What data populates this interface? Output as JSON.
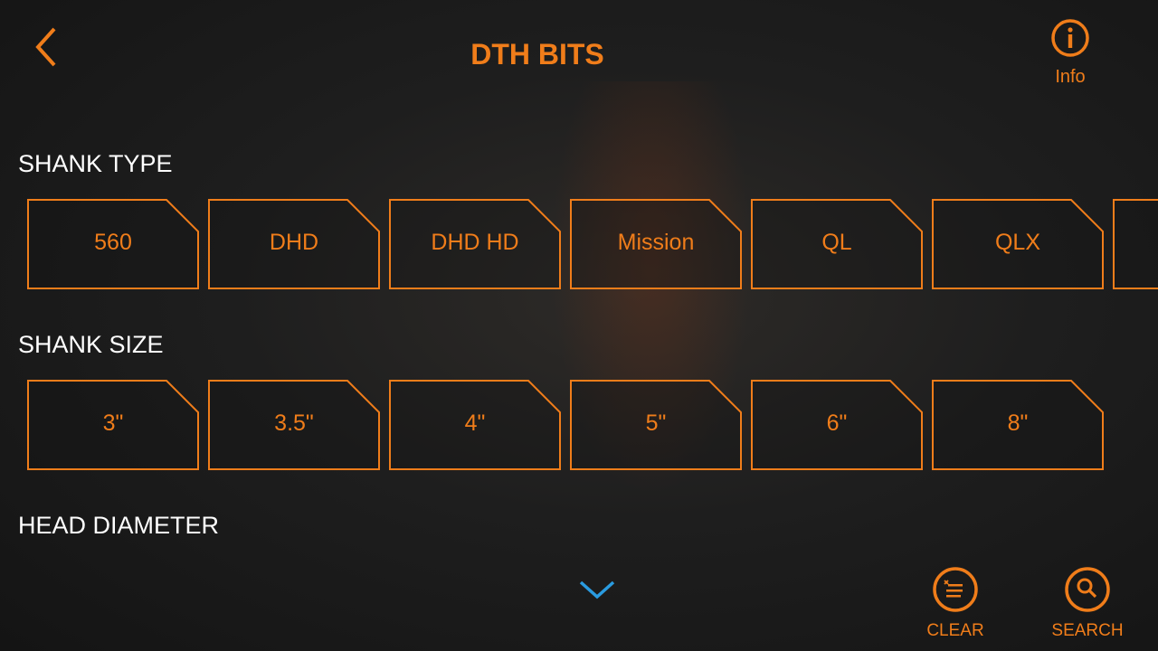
{
  "header": {
    "title": "DTH BITS",
    "info_label": "Info",
    "back_icon": "chevron-left-icon",
    "info_icon": "info-circle-icon"
  },
  "colors": {
    "accent": "#f07d1a",
    "scroll_indicator": "#2a9be0"
  },
  "sections": [
    {
      "title": "SHANK TYPE",
      "options": [
        "560",
        "DHD",
        "DHD HD",
        "Mission",
        "QL",
        "QLX",
        ""
      ]
    },
    {
      "title": "SHANK SIZE",
      "options": [
        "3\"",
        "3.5\"",
        "4\"",
        "5\"",
        "6\"",
        "8\""
      ]
    },
    {
      "title": "HEAD DIAMETER",
      "options": []
    }
  ],
  "actions": {
    "clear_label": "CLEAR",
    "search_label": "SEARCH"
  }
}
